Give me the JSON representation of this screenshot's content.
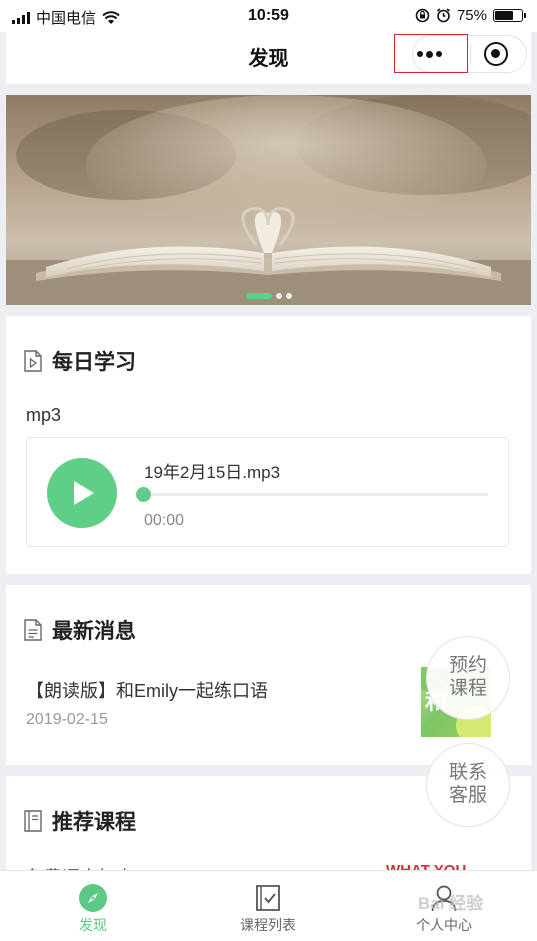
{
  "status_bar": {
    "carrier": "中国电信",
    "time": "10:59",
    "battery": "75%",
    "battery_level": 0.75
  },
  "nav": {
    "title": "发现"
  },
  "banner": {
    "slide_count": 3,
    "active_slide": 1
  },
  "daily": {
    "title": "每日学习",
    "type_label": "mp3",
    "track_name": "19年2月15日.mp3",
    "time": "00:00"
  },
  "news": {
    "title": "最新消息",
    "item_title": "【朗读版】和Emily一起练口语",
    "item_date": "2019-02-15",
    "thumb_text": "和"
  },
  "float": {
    "book_line1": "预约",
    "book_line2": "课程",
    "contact_line1": "联系",
    "contact_line2": "客服"
  },
  "courses": {
    "title": "推荐课程",
    "item_partial": "免费语音打卡",
    "thumb_text": "WHAT YOU"
  },
  "tabs": [
    {
      "label": "发现"
    },
    {
      "label": "课程列表"
    },
    {
      "label": "个人中心"
    }
  ],
  "watermark": "Bai 经验",
  "colors": {
    "accent": "#5bc883",
    "highlight_box": "#d9232a"
  }
}
